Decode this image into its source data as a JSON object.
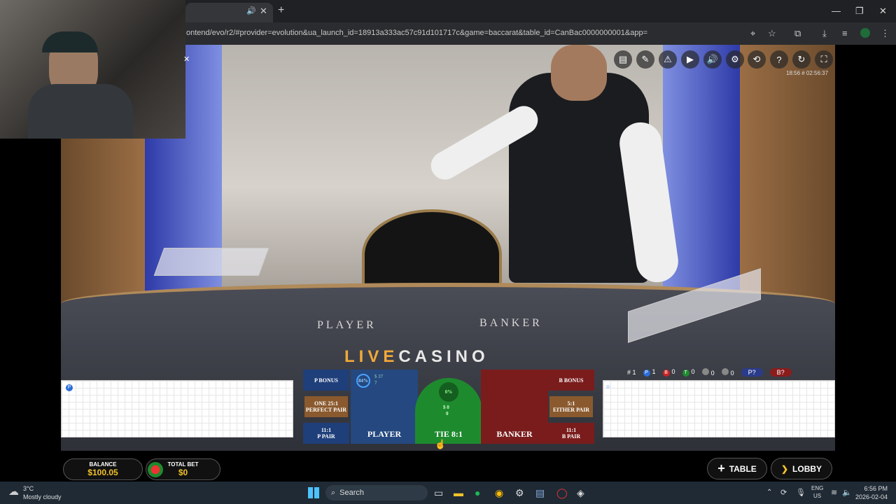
{
  "browser": {
    "tab_audio_icon": "speaker-icon",
    "url": "ontend/evo/r2/#provider=evolution&ua_launch_id=18913a333ac57c91d101717c&game=baccarat&table_id=CanBac0000000001&app="
  },
  "game": {
    "time": "18:56 # 02:56:37",
    "felt": {
      "player": "PLAYER",
      "banker": "BANKER",
      "logo_live": "LIVE",
      "logo_casino": "CASINO"
    },
    "bets": {
      "p_bonus": "P BONUS",
      "b_bonus": "B BONUS",
      "perfect_pair_odds": "ONE 25:1",
      "perfect_pair": "PERFECT PAIR",
      "either_pair_odds": "5:1",
      "either_pair": "EITHER PAIR",
      "p_pair_odds": "11:1",
      "p_pair": "P PAIR",
      "b_pair_odds": "11:1",
      "b_pair": "B PAIR",
      "player": "PLAYER",
      "banker": "BANKER",
      "tie": "TIE 8:1",
      "player_pct": "84%",
      "player_amount": "$ 37",
      "player_count": "7",
      "tie_pct": "0%",
      "tie_amount": "$ 0",
      "tie_count": "0"
    },
    "stats": {
      "round": "# 1",
      "p": "1",
      "b": "0",
      "t": "0",
      "pp": "0",
      "bp": "0",
      "p_pred": "P?",
      "b_pred": "B?"
    },
    "balance_label": "BALANCE",
    "balance": "$100.05",
    "total_bet_label": "TOTAL BET",
    "total_bet": "$0",
    "table_button": "TABLE",
    "lobby_button": "LOBBY"
  },
  "taskbar": {
    "weather_temp": "3°C",
    "weather_desc": "Mostly cloudy",
    "search": "Search",
    "lang1": "ENG",
    "lang2": "US",
    "clock_time": "6:56 PM",
    "clock_date": "2026-02-04"
  },
  "colors": {
    "player_blue": "#1f3f7a",
    "banker_red": "#7a1c1c",
    "tie_green": "#1e8a2e",
    "accent_gold": "#f2a93a"
  }
}
